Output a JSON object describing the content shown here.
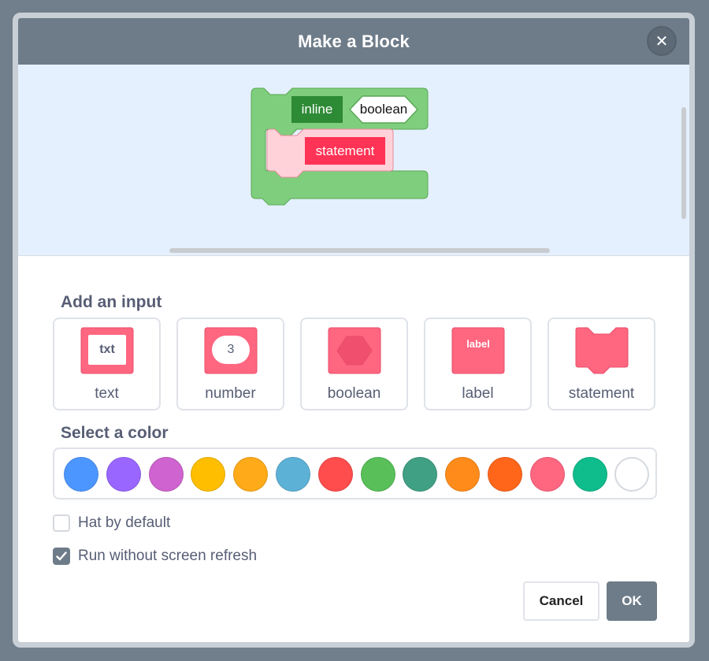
{
  "dialog": {
    "title": "Make a Block",
    "close_icon": "close-icon"
  },
  "preview": {
    "block": {
      "inline_label": "inline",
      "boolean_label": "boolean",
      "statement_label": "statement",
      "block_color": "#7fce7d",
      "inline_color": "#2d8a35",
      "statement_color": "#ff3355"
    }
  },
  "inputs": {
    "section_title": "Add an input",
    "items": [
      {
        "label": "text",
        "icon": "text-input-icon",
        "icon_text": "txt"
      },
      {
        "label": "number",
        "icon": "number-input-icon",
        "icon_text": "3"
      },
      {
        "label": "boolean",
        "icon": "boolean-input-icon"
      },
      {
        "label": "label",
        "icon": "label-input-icon",
        "icon_text": "label"
      },
      {
        "label": "statement",
        "icon": "statement-input-icon"
      }
    ]
  },
  "colors": {
    "section_title": "Select a color",
    "swatches": [
      "#4c97ff",
      "#9966ff",
      "#cf63cf",
      "#ffbf00",
      "#ffab19",
      "#5cb1d6",
      "#ff4c4c",
      "#59c059",
      "#40a084",
      "#ff8c1a",
      "#ff661a",
      "#ff6680",
      "#0fbd8c",
      "#ffffff"
    ]
  },
  "options": {
    "hat_by_default": {
      "label": "Hat by default",
      "checked": false
    },
    "run_without_refresh": {
      "label": "Run without screen refresh",
      "checked": true
    }
  },
  "buttons": {
    "cancel": "Cancel",
    "ok": "OK"
  },
  "theme": {
    "header_bg": "#6e7c89",
    "preview_bg": "#e5f0fe",
    "input_icon_color": "#ff6680"
  }
}
